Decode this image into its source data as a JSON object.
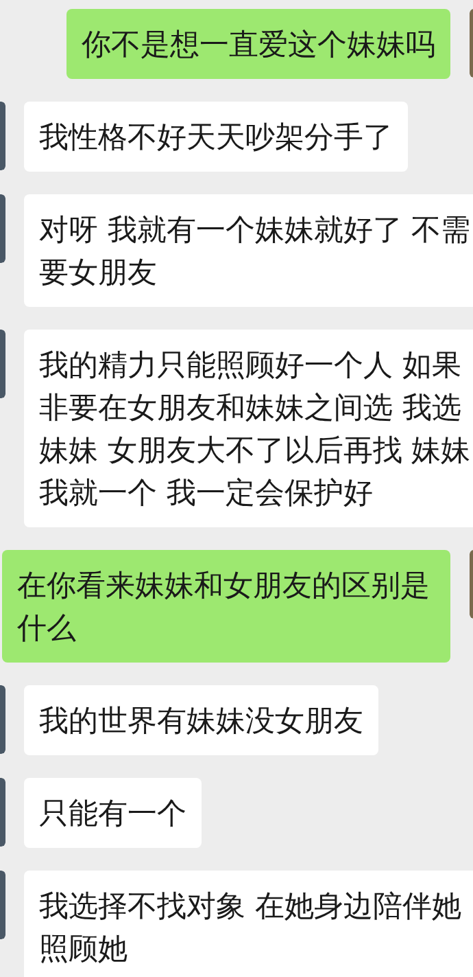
{
  "messages": [
    {
      "kind": "sent",
      "text": "你不是想一直爱这个妹妹吗"
    },
    {
      "kind": "received",
      "text": "我性格不好天天吵架分手了"
    },
    {
      "kind": "received",
      "text": "对呀 我就有一个妹妹就好了 不需要女朋友"
    },
    {
      "kind": "received",
      "text": "我的精力只能照顾好一个人 如果非要在女朋友和妹妹之间选 我选妹妹 女朋友大不了以后再找 妹妹我就一个 我一定会保护好"
    },
    {
      "kind": "sent",
      "text": "在你看来妹妹和女朋友的区别是什么"
    },
    {
      "kind": "received",
      "text": "我的世界有妹妹没女朋友"
    },
    {
      "kind": "received",
      "text": "只能有一个"
    },
    {
      "kind": "received",
      "text": "我选择不找对象 在她身边陪伴她照顾她"
    }
  ]
}
